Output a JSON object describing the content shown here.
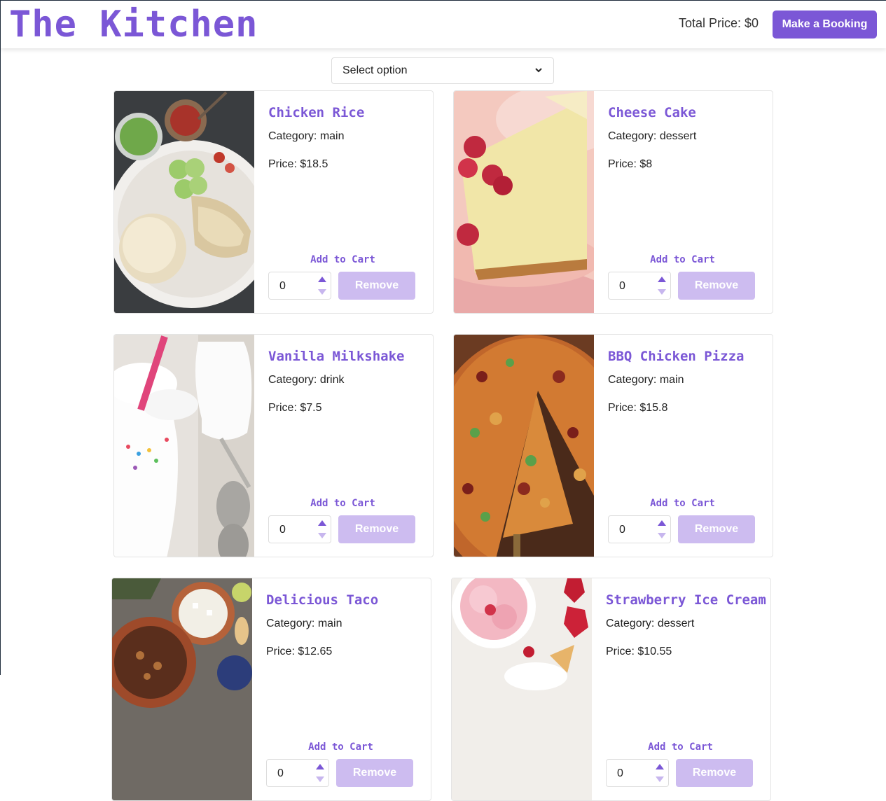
{
  "header": {
    "brand": "The Kitchen",
    "total_price": "Total Price: $0",
    "booking_button": "Make a Booking"
  },
  "filter": {
    "selected": "Select option"
  },
  "cards": [
    {
      "title": "Chicken Rice",
      "category": "Category: main",
      "price": "Price: $18.5",
      "add_label": "Add to Cart",
      "qty": "0",
      "remove": "Remove"
    },
    {
      "title": "Cheese Cake",
      "category": "Category: dessert",
      "price": "Price: $8",
      "add_label": "Add to Cart",
      "qty": "0",
      "remove": "Remove"
    },
    {
      "title": "Vanilla Milkshake",
      "category": "Category: drink",
      "price": "Price: $7.5",
      "add_label": "Add to Cart",
      "qty": "0",
      "remove": "Remove"
    },
    {
      "title": "BBQ Chicken Pizza",
      "category": "Category: main",
      "price": "Price: $15.8",
      "add_label": "Add to Cart",
      "qty": "0",
      "remove": "Remove"
    },
    {
      "title": "Delicious Taco",
      "category": "Category: main",
      "price": "Price: $12.65",
      "add_label": "Add to Cart",
      "qty": "0",
      "remove": "Remove"
    },
    {
      "title": "Strawberry Ice Cream",
      "category": "Category: dessert",
      "price": "Price: $10.55",
      "add_label": "Add to Cart",
      "qty": "0",
      "remove": "Remove"
    }
  ],
  "colors": {
    "accent": "#7b57d6",
    "accent_light": "#cdbcf0"
  }
}
